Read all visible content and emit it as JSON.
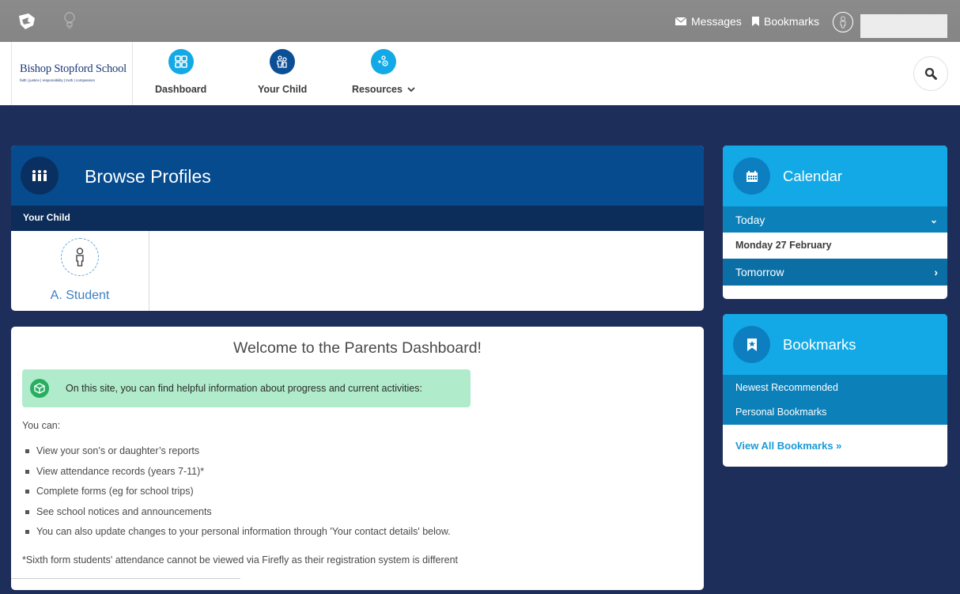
{
  "topbar": {
    "logo_icon": "firefly-logo-icon",
    "bulb_icon": "lightbulb-icon",
    "messages_label": "Messages",
    "bookmarks_label": "Bookmarks"
  },
  "school": {
    "name": "Bishop Stopford School",
    "motto": "faith | justice | responsibility | truth | compassion"
  },
  "nav": {
    "items": [
      {
        "label": "Dashboard",
        "icon": "dashboard-grid-icon",
        "color": "#12a9e6"
      },
      {
        "label": "Your Child",
        "icon": "child-people-icon",
        "color": "#0b4f96"
      },
      {
        "label": "Resources",
        "icon": "resources-icon",
        "color": "#12a9e6"
      }
    ]
  },
  "browse": {
    "title": "Browse Profiles",
    "section_label": "Your Child",
    "child_name": "A. Student"
  },
  "welcome": {
    "title": "Welcome to the Parents Dashboard!",
    "info_text": "On this site, you can find helpful information about progress and current activities:",
    "intro": "You can:",
    "bullets": [
      "View your son’s or daughter’s reports",
      "View attendance records (years 7-11)*",
      "Complete forms (eg for school trips)",
      "See school notices and announcements",
      "You can also update changes to your personal information through 'Your contact details' below."
    ],
    "footnote": "*Sixth form students' attendance cannot be viewed via Firefly as their registration system is different"
  },
  "calendar": {
    "title": "Calendar",
    "today_label": "Today",
    "today_date": "Monday 27 February",
    "tomorrow_label": "Tomorrow"
  },
  "bookmarks_panel": {
    "title": "Bookmarks",
    "newest": "Newest Recommended",
    "personal": "Personal Bookmarks",
    "view_all": "View All Bookmarks »"
  },
  "colors": {
    "background": "#1e2e5a",
    "browse_header": "#064b8e",
    "calendar_header": "#12a9e6",
    "info_box": "#b0eccb"
  }
}
